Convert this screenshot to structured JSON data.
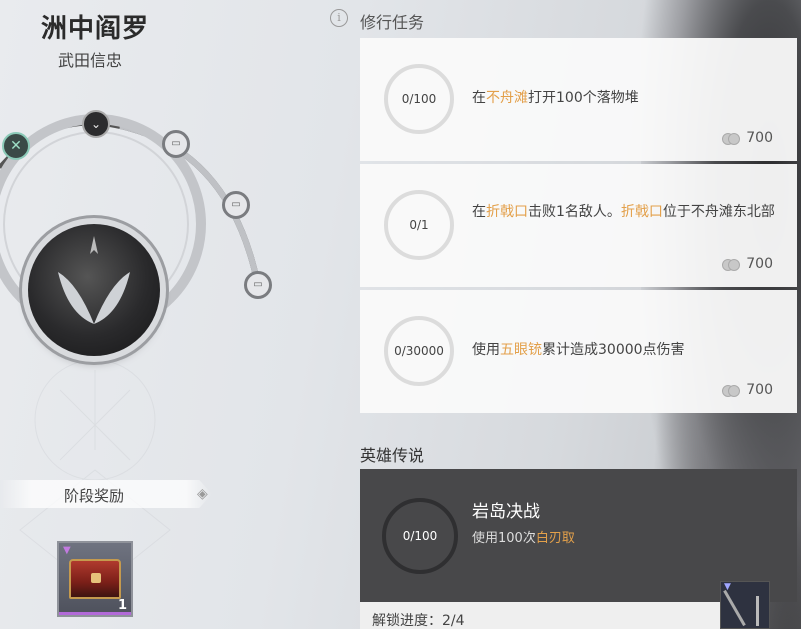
{
  "hero": {
    "name": "洲中阎罗",
    "subtitle": "武田信忠"
  },
  "stage_reward": {
    "label": "阶段奖励",
    "item_count": "1"
  },
  "tasks_section": {
    "title": "修行任务",
    "tasks": [
      {
        "progress": "0/100",
        "text_parts": [
          "在",
          "不舟滩",
          "打开100个落物堆"
        ],
        "reward": "700"
      },
      {
        "progress": "0/1",
        "text_parts": [
          "在",
          "折戟口",
          "击败1名敌人。",
          "折戟口",
          "位于不舟滩东北部"
        ],
        "reward": "700"
      },
      {
        "progress": "0/30000",
        "text_parts": [
          "使用",
          "五眼铳",
          "累计造成30000点伤害"
        ],
        "reward": "700"
      }
    ]
  },
  "legend_section": {
    "title": "英雄传说",
    "card": {
      "progress": "0/100",
      "title": "岩岛决战",
      "desc_parts": [
        "使用100次",
        "白刃取"
      ]
    },
    "unlock_text": "解锁进度：2/4"
  },
  "colors": {
    "highlight": "#e3a04a",
    "legend_card_bg": "#48484a"
  }
}
